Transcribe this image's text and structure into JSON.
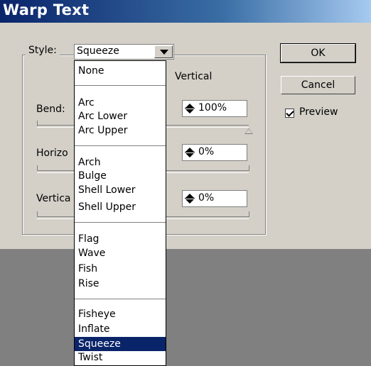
{
  "window": {
    "title": "Warp Text"
  },
  "style": {
    "label": "Style:",
    "value": "Squeeze",
    "options": [
      "None",
      "Arc",
      "Arc Lower",
      "Arc Upper",
      "Arch",
      "Bulge",
      "Shell Lower",
      "Shell Upper",
      "Flag",
      "Wave",
      "Fish",
      "Rise",
      "Fisheye",
      "Inflate",
      "Squeeze",
      "Twist"
    ]
  },
  "orientation": {
    "vertical_label": "Vertical"
  },
  "bend": {
    "label": "Bend:",
    "value": "100%",
    "level": 1.0
  },
  "horizontal": {
    "label": "Horizo",
    "value": "0%"
  },
  "vertical": {
    "label": "Vertica",
    "value": "0%"
  },
  "buttons": {
    "ok": "OK",
    "cancel": "Cancel"
  },
  "preview": {
    "label": "Preview",
    "checked": true
  }
}
